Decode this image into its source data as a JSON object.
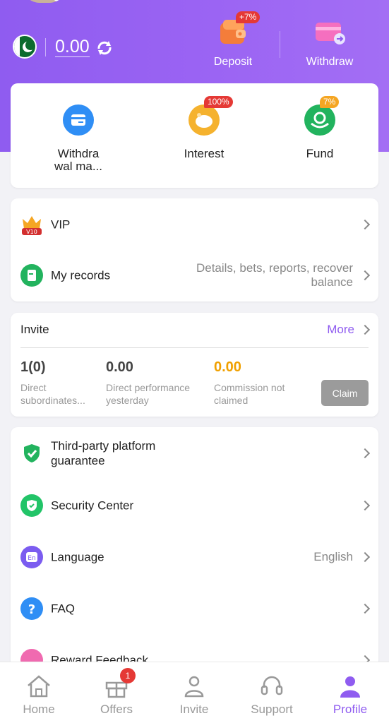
{
  "header": {
    "balance": "0.00",
    "deposit": {
      "label": "Deposit",
      "badge": "+7%"
    },
    "withdraw": {
      "label": "Withdraw"
    }
  },
  "quick_actions": [
    {
      "label": "Withdra wal ma...",
      "badge": "",
      "icon": "card-icon"
    },
    {
      "label": "Interest",
      "badge": "100%",
      "icon": "piggy-bank-icon"
    },
    {
      "label": "Fund",
      "badge": "7%",
      "icon": "fund-icon"
    }
  ],
  "menu1": {
    "vip": {
      "label": "VIP",
      "badge": "V10"
    },
    "records": {
      "label": "My records",
      "hint": "Details, bets, reports, recover balance"
    }
  },
  "invite": {
    "title": "Invite",
    "more": "More",
    "stats": [
      {
        "value": "1(0)",
        "desc": "Direct subordinates..."
      },
      {
        "value": "0.00",
        "desc": "Direct performance yesterday"
      },
      {
        "value": "0.00",
        "desc": "Commission not claimed"
      }
    ],
    "claim": "Claim"
  },
  "menu2": [
    {
      "label": "Third-party platform guarantee",
      "right": ""
    },
    {
      "label": "Security Center",
      "right": ""
    },
    {
      "label": "Language",
      "right": "English"
    },
    {
      "label": "FAQ",
      "right": ""
    },
    {
      "label": "Reward Feedback",
      "right": ""
    }
  ],
  "nav": {
    "home": "Home",
    "offers": "Offers",
    "offers_badge": "1",
    "invite": "Invite",
    "support": "Support",
    "profile": "Profile"
  },
  "colors": {
    "accent": "#8f5cf0",
    "commission": "#f0a000",
    "badge_red": "#e53935"
  }
}
